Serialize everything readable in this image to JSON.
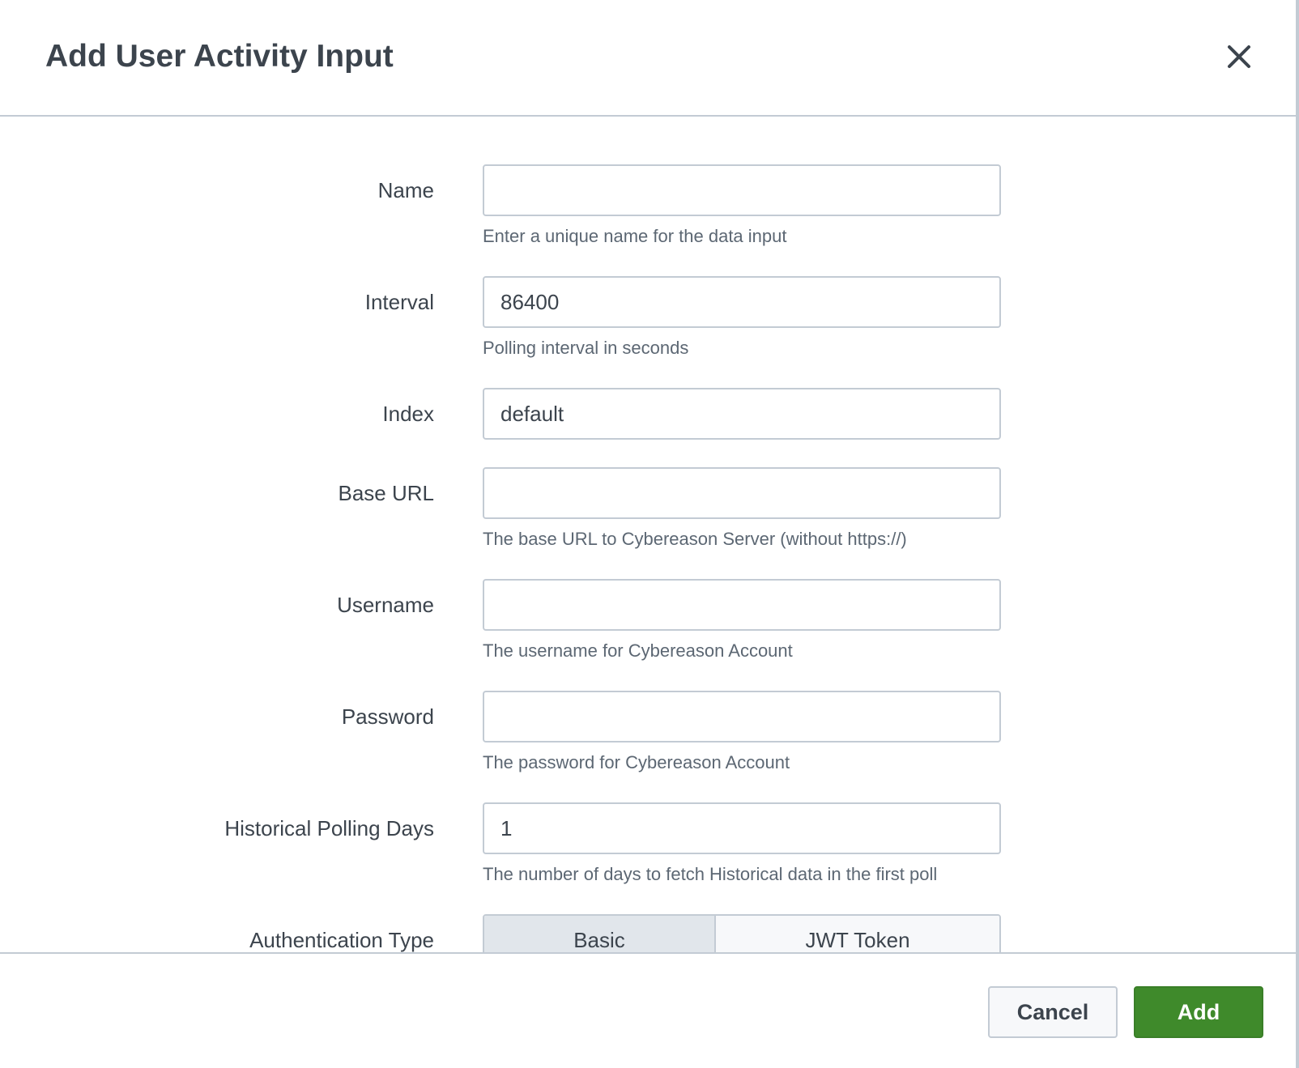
{
  "dialog": {
    "title": "Add User Activity Input",
    "close_icon": "close-icon"
  },
  "form": {
    "name": {
      "label": "Name",
      "value": "",
      "help": "Enter a unique name for the data input"
    },
    "interval": {
      "label": "Interval",
      "value": "86400",
      "help": "Polling interval in seconds"
    },
    "index": {
      "label": "Index",
      "value": "default"
    },
    "base_url": {
      "label": "Base URL",
      "value": "",
      "help": "The base URL to Cybereason Server (without https://)"
    },
    "username": {
      "label": "Username",
      "value": "",
      "help": "The username for Cybereason Account"
    },
    "password": {
      "label": "Password",
      "value": "",
      "help": "The password for Cybereason Account"
    },
    "historical_days": {
      "label": "Historical Polling Days",
      "value": "1",
      "help": "The number of days to fetch Historical data in the first poll"
    },
    "auth_type": {
      "label": "Authentication Type",
      "options": [
        "Basic",
        "JWT Token"
      ],
      "selected": "Basic"
    }
  },
  "footer": {
    "cancel_label": "Cancel",
    "add_label": "Add"
  },
  "colors": {
    "primary": "#3f8a2b",
    "border": "#c3cbd4",
    "text": "#3c444d",
    "help_text": "#5c6773",
    "toggle_selected": "#e1e6eb"
  }
}
